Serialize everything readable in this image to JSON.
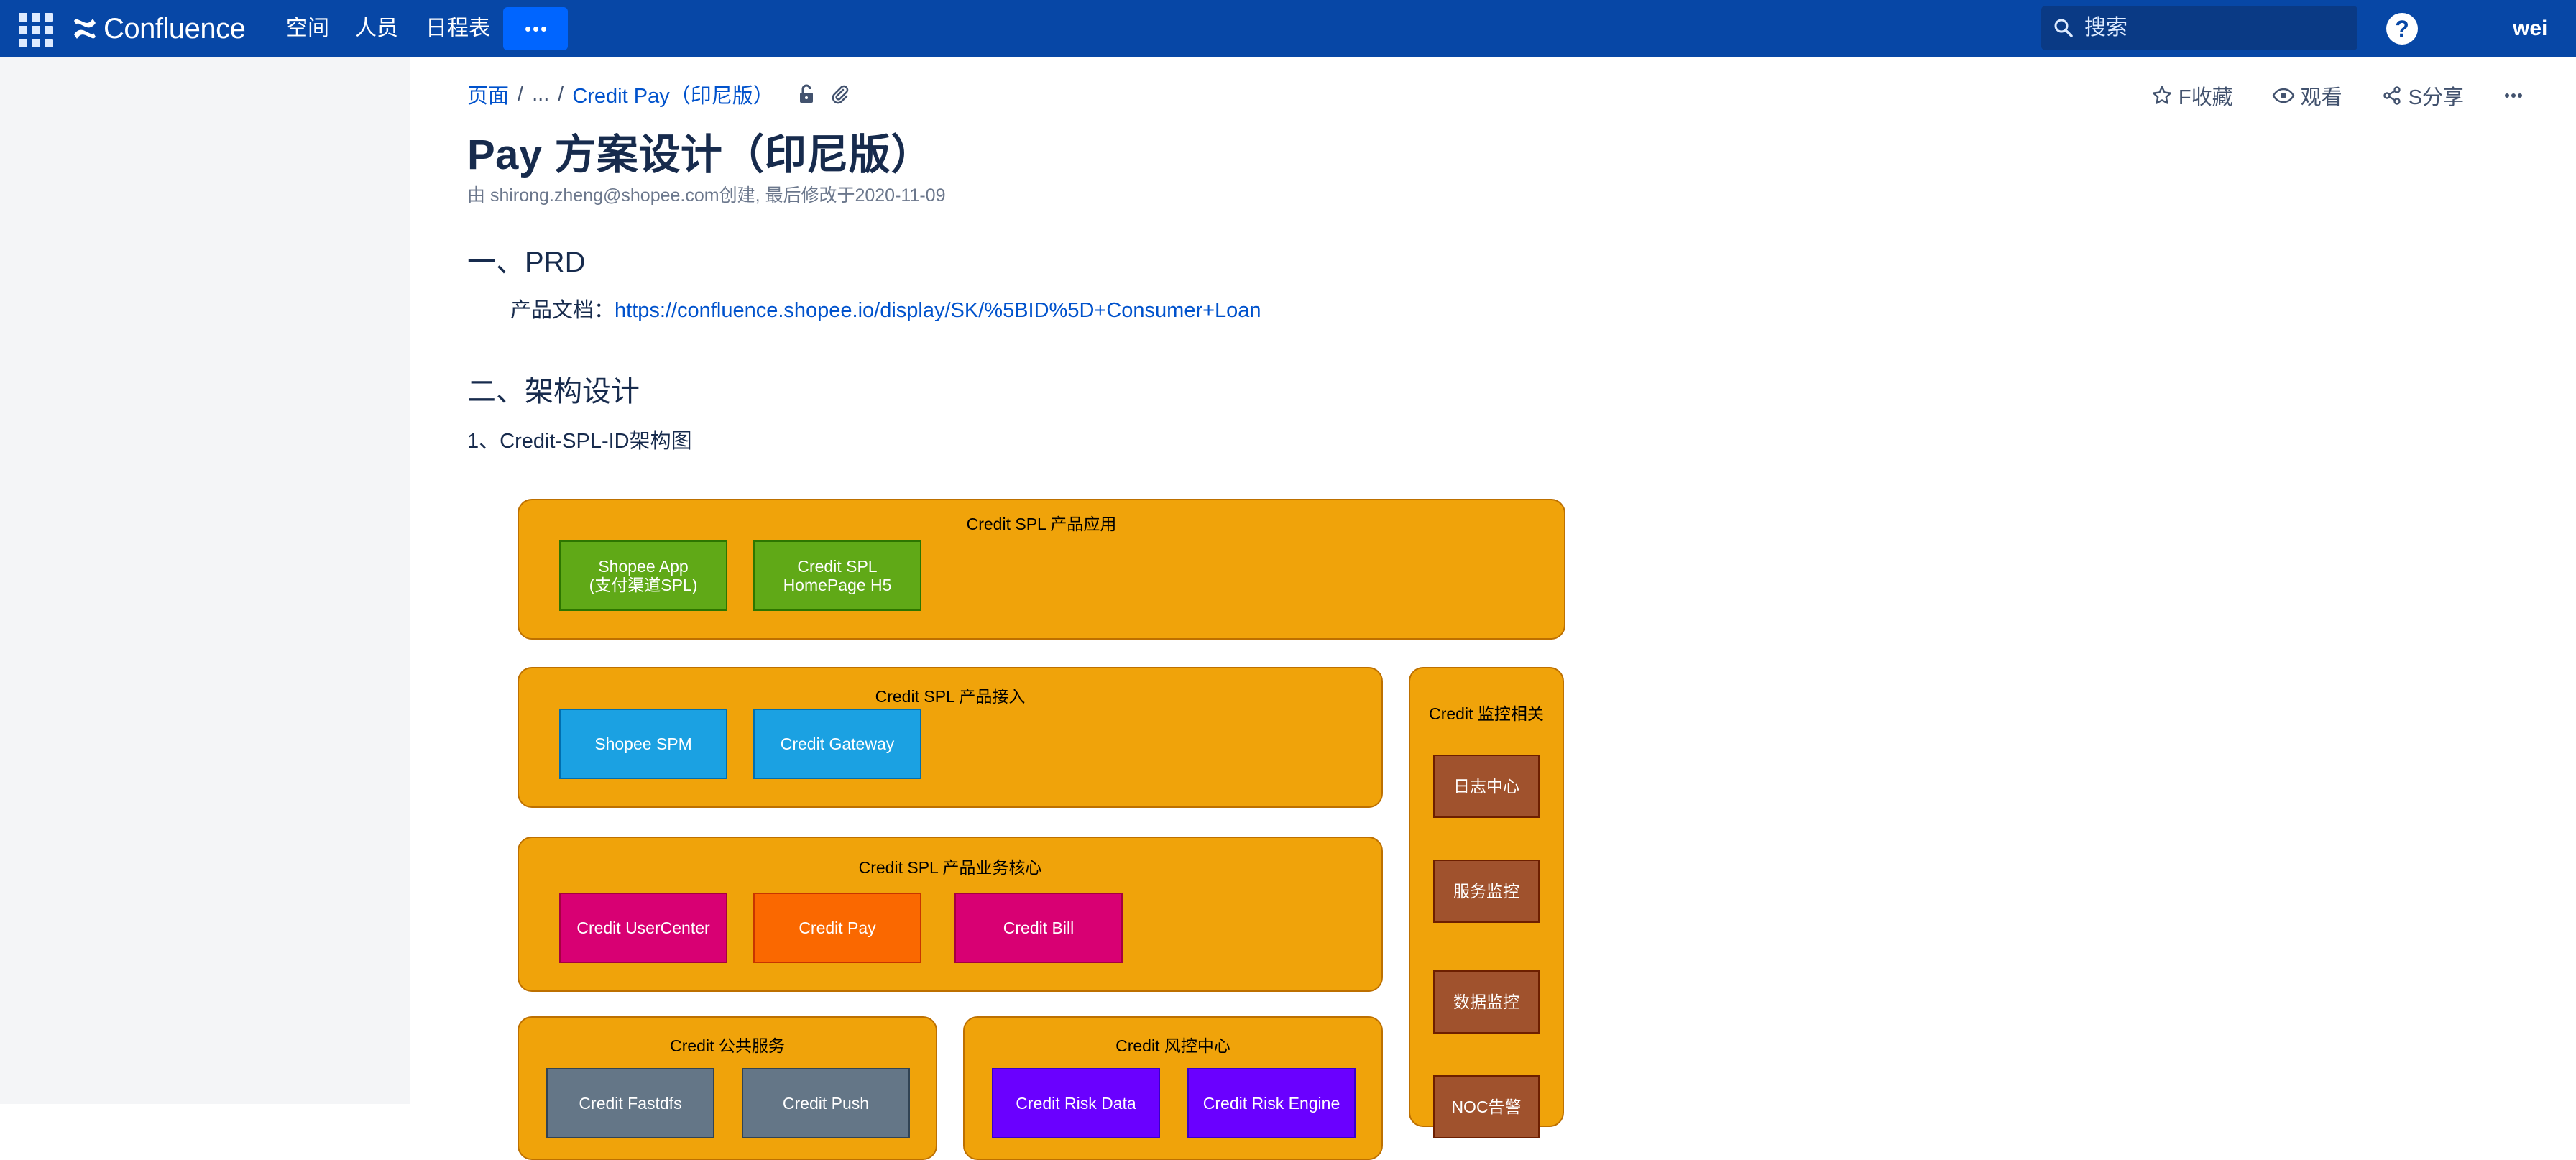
{
  "topnav": {
    "brand": "Confluence",
    "links": [
      "空间",
      "人员",
      "日程表"
    ],
    "more_label": "···",
    "search_placeholder": "搜索",
    "help_label": "?",
    "user": "wei"
  },
  "breadcrumb": {
    "root": "页面",
    "ellipsis": "...",
    "parent": "Credit Pay（印尼版）"
  },
  "actions": {
    "favorite": "F收藏",
    "watch": "观看",
    "share": "S分享"
  },
  "page": {
    "title": "Pay 方案设计（印尼版）",
    "byline": "由 shirong.zheng@shopee.com创建, 最后修改于2020-11-09",
    "section1_heading": "一、PRD",
    "prd_label": "产品文档：",
    "prd_link": "https://confluence.shopee.io/display/SK/%5BID%5D+Consumer+Loan",
    "section2_heading": "二、架构设计",
    "subsection1": "1、Credit-SPL-ID架构图"
  },
  "diagram": {
    "app_group": {
      "title": "Credit SPL 产品应用",
      "boxes": [
        "Shopee App\n(支付渠道SPL)",
        "Credit SPL\nHomePage H5"
      ]
    },
    "access_group": {
      "title": "Credit SPL 产品接入",
      "boxes": [
        "Shopee SPM",
        "Credit Gateway"
      ]
    },
    "core_group": {
      "title": "Credit SPL 产品业务核心",
      "boxes": [
        "Credit UserCenter",
        "Credit Pay",
        "Credit Bill"
      ]
    },
    "monitor_group": {
      "title": "Credit 监控相关",
      "boxes": [
        "日志中心",
        "服务监控",
        "数据监控",
        "NOC告警"
      ]
    },
    "public_group": {
      "title": "Credit 公共服务",
      "boxes": [
        "Credit Fastdfs",
        "Credit Push"
      ]
    },
    "risk_group": {
      "title": "Credit 风控中心",
      "boxes": [
        "Credit Risk Data",
        "Credit Risk Engine"
      ]
    }
  },
  "colors": {
    "nav": "#0747a6",
    "group_fill": "#f0a30a",
    "green": "#60a917",
    "blue": "#1ba1e2",
    "pink": "#d80073",
    "orange": "#fa6800",
    "brown": "#a0522d",
    "grey": "#647687",
    "violet": "#6a00ff"
  }
}
